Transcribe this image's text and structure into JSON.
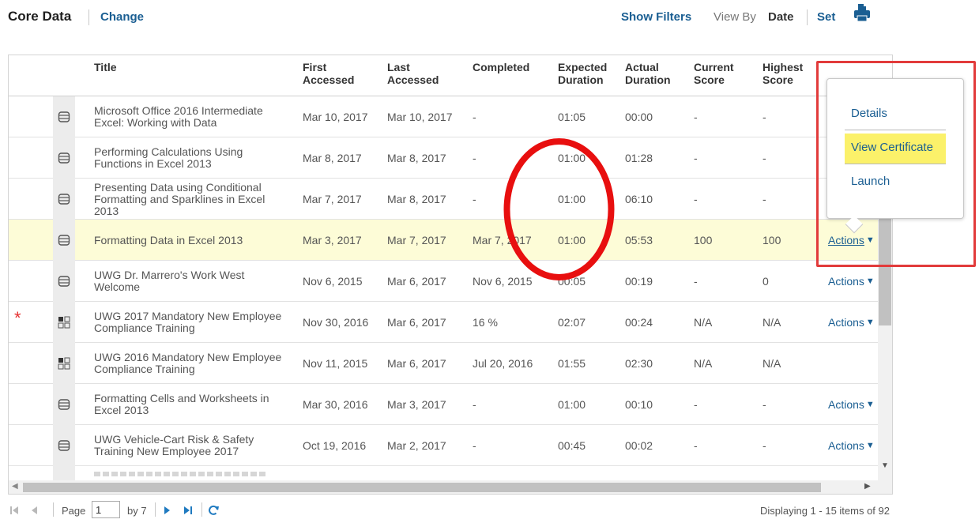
{
  "header": {
    "title": "Core Data",
    "change_label": "Change",
    "show_filters_label": "Show Filters",
    "view_by_label": "View By",
    "view_by_value": "Date",
    "set_label": "Set"
  },
  "table": {
    "columns": {
      "title": "Title",
      "first_accessed": "First Accessed",
      "last_accessed": "Last Accessed",
      "completed": "Completed",
      "expected_duration": "Expected Duration",
      "actual_duration": "Actual Duration",
      "current_score": "Current Score",
      "highest_score": "Highest Score"
    },
    "rows": [
      {
        "title": "Microsoft Office 2016 Intermediate Excel: Working with Data",
        "first": "Mar 10, 2017",
        "last": "Mar 10, 2017",
        "completed": "-",
        "expected": "01:05",
        "actual": "00:00",
        "current": "-",
        "highest": "-",
        "actions": "",
        "icon": "course-stack-icon",
        "star": ""
      },
      {
        "title": "Performing Calculations Using Functions in Excel 2013",
        "first": "Mar 8, 2017",
        "last": "Mar 8, 2017",
        "completed": "-",
        "expected": "01:00",
        "actual": "01:28",
        "current": "-",
        "highest": "-",
        "actions": "",
        "icon": "course-stack-icon",
        "star": ""
      },
      {
        "title": "Presenting Data using Conditional Formatting and Sparklines in Excel 2013",
        "first": "Mar 7, 2017",
        "last": "Mar 8, 2017",
        "completed": "-",
        "expected": "01:00",
        "actual": "06:10",
        "current": "-",
        "highest": "-",
        "actions": "",
        "icon": "course-stack-icon",
        "star": ""
      },
      {
        "title": "Formatting Data in Excel 2013",
        "first": "Mar 3, 2017",
        "last": "Mar 7, 2017",
        "completed": "Mar 7, 2017",
        "expected": "01:00",
        "actual": "05:53",
        "current": "100",
        "highest": "100",
        "actions": "Actions",
        "icon": "course-stack-icon",
        "star": ""
      },
      {
        "title": "UWG Dr. Marrero's Work West Welcome",
        "first": "Nov 6, 2015",
        "last": "Mar 6, 2017",
        "completed": "Nov 6, 2015",
        "expected": "00:05",
        "actual": "00:19",
        "current": "-",
        "highest": "0",
        "actions": "Actions",
        "icon": "course-stack-icon",
        "star": ""
      },
      {
        "title": "UWG 2017 Mandatory New Employee Compliance Training",
        "first": "Nov 30, 2016",
        "last": "Mar 6, 2017",
        "completed": "16 %",
        "expected": "02:07",
        "actual": "00:24",
        "current": "N/A",
        "highest": "N/A",
        "actions": "Actions",
        "icon": "curriculum-grid-icon",
        "star": "*"
      },
      {
        "title": "UWG 2016 Mandatory New Employee Compliance Training",
        "first": "Nov 11, 2015",
        "last": "Mar 6, 2017",
        "completed": "Jul 20, 2016",
        "expected": "01:55",
        "actual": "02:30",
        "current": "N/A",
        "highest": "N/A",
        "actions": "",
        "icon": "curriculum-grid-icon",
        "star": ""
      },
      {
        "title": "Formatting Cells and Worksheets in Excel 2013",
        "first": "Mar 30, 2016",
        "last": "Mar 3, 2017",
        "completed": "-",
        "expected": "01:00",
        "actual": "00:10",
        "current": "-",
        "highest": "-",
        "actions": "Actions",
        "icon": "course-stack-icon",
        "star": ""
      },
      {
        "title": "UWG Vehicle-Cart Risk & Safety Training New Employee 2017",
        "first": "Oct 19, 2016",
        "last": "Mar 2, 2017",
        "completed": "-",
        "expected": "00:45",
        "actual": "00:02",
        "current": "-",
        "highest": "-",
        "actions": "Actions",
        "icon": "course-stack-icon",
        "star": ""
      }
    ]
  },
  "popup": {
    "details": "Details",
    "view_certificate": "View Certificate",
    "launch": "Launch"
  },
  "pager": {
    "page_label": "Page",
    "page_value": "1",
    "of_label": "by 7",
    "display_text": "Displaying 1 - 15 items of 92"
  },
  "colors": {
    "link": "#1a5e92",
    "row_highlight": "#fdfcd7",
    "menu_highlight": "#fbf16a",
    "annotation_red": "#e23b3b",
    "star": "#e53030"
  }
}
